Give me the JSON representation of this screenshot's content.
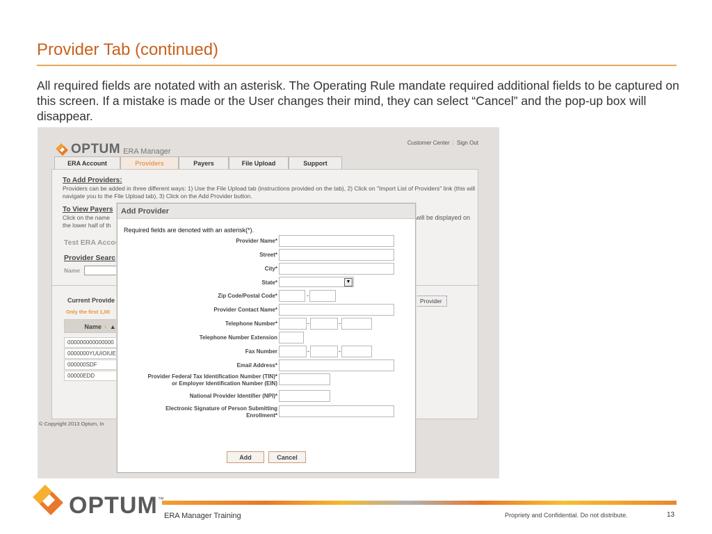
{
  "slide": {
    "title": "Provider Tab (continued)",
    "intro": "All required fields are notated with an asterisk.  The Operating Rule mandate required additional fields to be captured on this screen.  If a mistake is made or the User changes their mind, they can select “Cancel” and the pop-up box will disappear."
  },
  "app": {
    "brand": "OPTUM",
    "brand_tm": "™",
    "product": "ERA Manager",
    "links": {
      "customer_center": "Customer Center",
      "sign_out": "Sign Out"
    },
    "tabs": [
      {
        "label": "ERA Account"
      },
      {
        "label": "Providers",
        "active": true
      },
      {
        "label": "Payers"
      },
      {
        "label": "File Upload"
      },
      {
        "label": "Support"
      }
    ],
    "add_providers_heading": "To Add Providers:",
    "add_providers_text": "Providers can be added in three different ways: 1) Use the File Upload tab (instructions provided on the tab), 2) Click on \"Import List of Providers\" link (this will navigate you to the File Upload tab), 3) Click on the Add Provider button.",
    "view_payers_heading": "To View Payers",
    "view_text_left_1": "Click on the name",
    "view_text_left_2": "the lower half of th",
    "view_text_right": "will be displayed on",
    "account_name": "Test ERA Accou",
    "provider_search": "Provider Searc",
    "name_label": "Name",
    "current_providers": "Current Provide",
    "only_first": "Only the first 1,00",
    "add_provider_btn": "Provider",
    "table_header": "Name",
    "table_rows": [
      "000000000000000",
      "0000000YUUIOIUE",
      "000000SDF",
      "00000EDD"
    ],
    "copyright": "© Copyright 2013 Optum, In"
  },
  "dialog": {
    "title": "Add Provider",
    "note": "Required fields are denoted with an asterisk(*).",
    "fields": {
      "provider_name": "Provider Name*",
      "street": "Street*",
      "city": "City*",
      "state": "State*",
      "zip": "Zip Code/Postal Code*",
      "contact": "Provider Contact Name*",
      "phone": "Telephone Number*",
      "ext": "Telephone Number Extension",
      "fax": "Fax Number",
      "email": "Email Address*",
      "tin_1": "Provider Federal Tax Identification Number (TIN)*",
      "tin_2": "or Employer Identification Number (EIN)",
      "npi": "National Provider Identifier (NPI)*",
      "sig_1": "Electronic Signature of Person Submitting",
      "sig_2": "Enrollment*"
    },
    "add_label": "Add",
    "cancel_label": "Cancel"
  },
  "footer": {
    "brand": "OPTUM",
    "tm": "™",
    "left": "ERA Manager Training",
    "right": "Propriety and Confidential. Do not distribute.",
    "page": "13"
  },
  "colors": {
    "accent": "#c8611f",
    "active_tab": "#e39a5c",
    "warning_text": "#e8913a"
  }
}
